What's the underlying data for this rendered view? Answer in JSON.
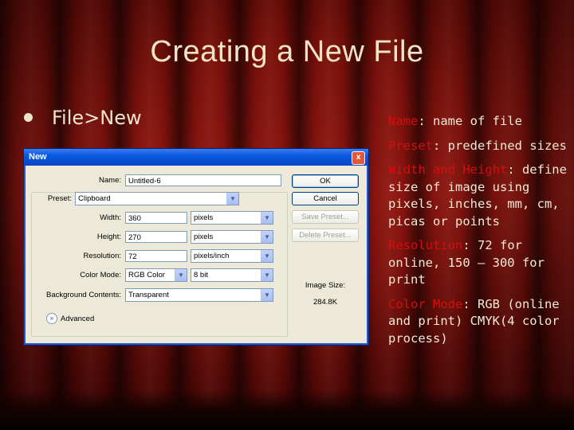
{
  "slide": {
    "title": "Creating a New File",
    "bullet": "File>New"
  },
  "notes": [
    {
      "key": "Name",
      "text": ": name of file"
    },
    {
      "key": "Preset",
      "text": ": predefined sizes"
    },
    {
      "key": "Width and Height",
      "text": ": define size of image using pixels, inches, mm, cm, picas or points"
    },
    {
      "key": "Resolution",
      "text": ": 72 for online, 150 – 300 for print"
    },
    {
      "key": "Color Mode",
      "text": ": RGB (online and print) CMYK(4 color process)"
    }
  ],
  "dialog": {
    "title": "New",
    "close": "x",
    "name_label": "Name:",
    "name_value": "Untitled-6",
    "preset_label": "Preset:",
    "preset_value": "Clipboard",
    "width_label": "Width:",
    "width_value": "360",
    "width_unit": "pixels",
    "height_label": "Height:",
    "height_value": "270",
    "height_unit": "pixels",
    "resolution_label": "Resolution:",
    "resolution_value": "72",
    "resolution_unit": "pixels/inch",
    "colormode_label": "Color Mode:",
    "colormode_value": "RGB Color",
    "colordepth_value": "8 bit",
    "background_label": "Background Contents:",
    "background_value": "Transparent",
    "advanced_label": "Advanced",
    "ok": "OK",
    "cancel": "Cancel",
    "save_preset": "Save Preset...",
    "delete_preset": "Delete Preset...",
    "image_size_label": "Image Size:",
    "image_size_value": "284.8K"
  }
}
